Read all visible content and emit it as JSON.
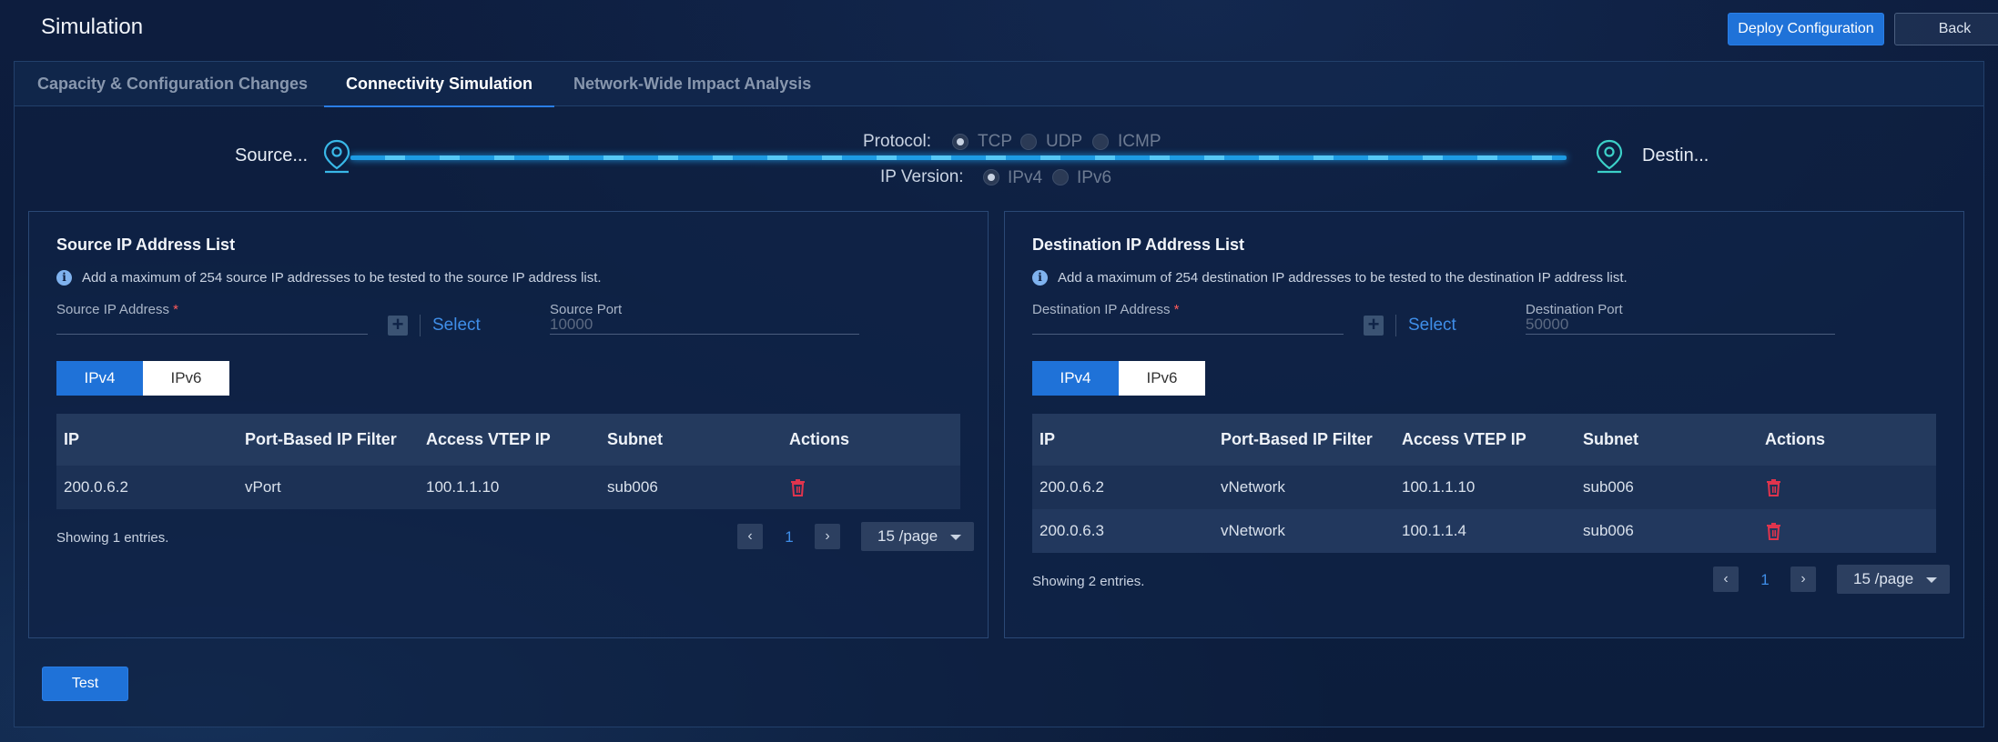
{
  "header": {
    "title": "Simulation",
    "deploy_label": "Deploy Configuration",
    "back_label": "Back"
  },
  "tabs": [
    {
      "label": "Capacity & Configuration Changes",
      "active": false
    },
    {
      "label": "Connectivity Simulation",
      "active": true
    },
    {
      "label": "Network-Wide Impact Analysis",
      "active": false
    }
  ],
  "flow": {
    "source_label": "Source...",
    "destination_label": "Destin...",
    "protocol_label": "Protocol:",
    "protocol_options": [
      "TCP",
      "UDP",
      "ICMP"
    ],
    "protocol_selected": "TCP",
    "ip_version_label": "IP Version:",
    "ip_version_options": [
      "IPv4",
      "IPv6"
    ],
    "ip_version_selected": "IPv4"
  },
  "source_card": {
    "title": "Source IP Address List",
    "info": "Add a maximum of 254 source IP addresses to be tested to the source IP address list.",
    "ip_field_label": "Source IP Address",
    "ip_field_value": "",
    "select_label": "Select",
    "port_field_label": "Source Port",
    "port_field_value": "10000",
    "ip_tabs": [
      "IPv4",
      "IPv6"
    ],
    "columns": [
      "IP",
      "Port-Based IP Filter",
      "Access VTEP IP",
      "Subnet",
      "Actions"
    ],
    "rows": [
      [
        "200.0.6.2",
        "vPort",
        "100.1.1.10",
        "sub006"
      ]
    ],
    "showing": "Showing 1 entries.",
    "page": "1",
    "page_size": "15 /page"
  },
  "destination_card": {
    "title": "Destination IP Address List",
    "info": "Add a maximum of 254 destination IP addresses to be tested to the destination IP address list.",
    "ip_field_label": "Destination IP Address",
    "ip_field_value": "",
    "select_label": "Select",
    "port_field_label": "Destination Port",
    "port_field_value": "50000",
    "ip_tabs": [
      "IPv4",
      "IPv6"
    ],
    "columns": [
      "IP",
      "Port-Based IP Filter",
      "Access VTEP IP",
      "Subnet",
      "Actions"
    ],
    "rows": [
      [
        "200.0.6.2",
        "vNetwork",
        "100.1.1.10",
        "sub006"
      ],
      [
        "200.0.6.3",
        "vNetwork",
        "100.1.1.4",
        "sub006"
      ]
    ],
    "showing": "Showing 2 entries.",
    "page": "1",
    "page_size": "15 /page"
  },
  "test_label": "Test",
  "colors": {
    "primary": "#1f72d8",
    "link": "#3f8ee8",
    "danger": "#e0344d",
    "flow_line": "#1d9be3"
  }
}
